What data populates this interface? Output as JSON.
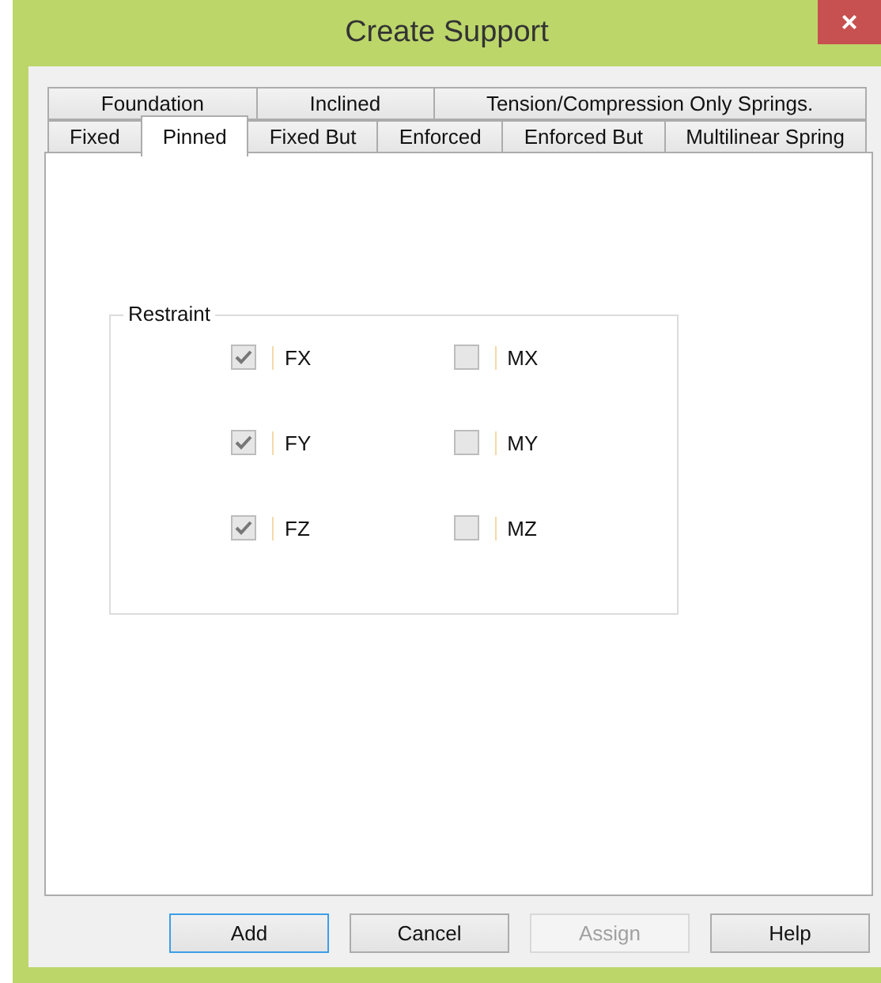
{
  "window": {
    "title": "Create Support",
    "close": "×"
  },
  "tab_rows": [
    [
      {
        "label": "Foundation",
        "selected": false
      },
      {
        "label": "Inclined",
        "selected": false
      },
      {
        "label": "Tension/Compression Only Springs.",
        "selected": false
      }
    ],
    [
      {
        "label": "Fixed",
        "selected": false
      },
      {
        "label": "Pinned",
        "selected": true
      },
      {
        "label": "Fixed But",
        "selected": false
      },
      {
        "label": "Enforced",
        "selected": false
      },
      {
        "label": "Enforced But",
        "selected": false
      },
      {
        "label": "Multilinear Spring",
        "selected": false
      }
    ]
  ],
  "restraint": {
    "title": "Restraint",
    "columns": [
      [
        {
          "label": "FX",
          "checked": true
        },
        {
          "label": "FY",
          "checked": true
        },
        {
          "label": "FZ",
          "checked": true
        }
      ],
      [
        {
          "label": "MX",
          "checked": false
        },
        {
          "label": "MY",
          "checked": false
        },
        {
          "label": "MZ",
          "checked": false
        }
      ]
    ]
  },
  "buttons": [
    {
      "label": "Add",
      "default": true,
      "disabled": false
    },
    {
      "label": "Cancel",
      "default": false,
      "disabled": false
    },
    {
      "label": "Assign",
      "default": false,
      "disabled": true
    },
    {
      "label": "Help",
      "default": false,
      "disabled": false
    }
  ]
}
